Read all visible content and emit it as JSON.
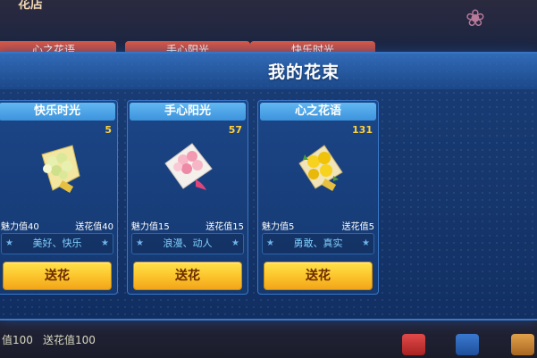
{
  "background": {
    "top_title": "花店",
    "tabs": [
      "心之花语",
      "手心阳光",
      "快乐时光"
    ],
    "bottom": {
      "charm_text": "值100",
      "send_text": "送花值100"
    }
  },
  "panel": {
    "title": "我的花束",
    "cards": [
      {
        "name": "快乐时光",
        "count": "5",
        "charm": "魅力值40",
        "send": "送花值40",
        "desc": "美好、快乐",
        "button": "送花",
        "bouquet": "yellow-green-bouquet"
      },
      {
        "name": "手心阳光",
        "count": "57",
        "charm": "魅力值15",
        "send": "送花值15",
        "desc": "浪漫、动人",
        "button": "送花",
        "bouquet": "pink-rose-bouquet"
      },
      {
        "name": "心之花语",
        "count": "131",
        "charm": "魅力值5",
        "send": "送花值5",
        "desc": "勇敢、真实",
        "button": "送花",
        "bouquet": "yellow-rose-bouquet"
      }
    ]
  },
  "colors": {
    "accent": "#3d93dc",
    "button": "#fbc22a",
    "count": "#ffd23a"
  }
}
